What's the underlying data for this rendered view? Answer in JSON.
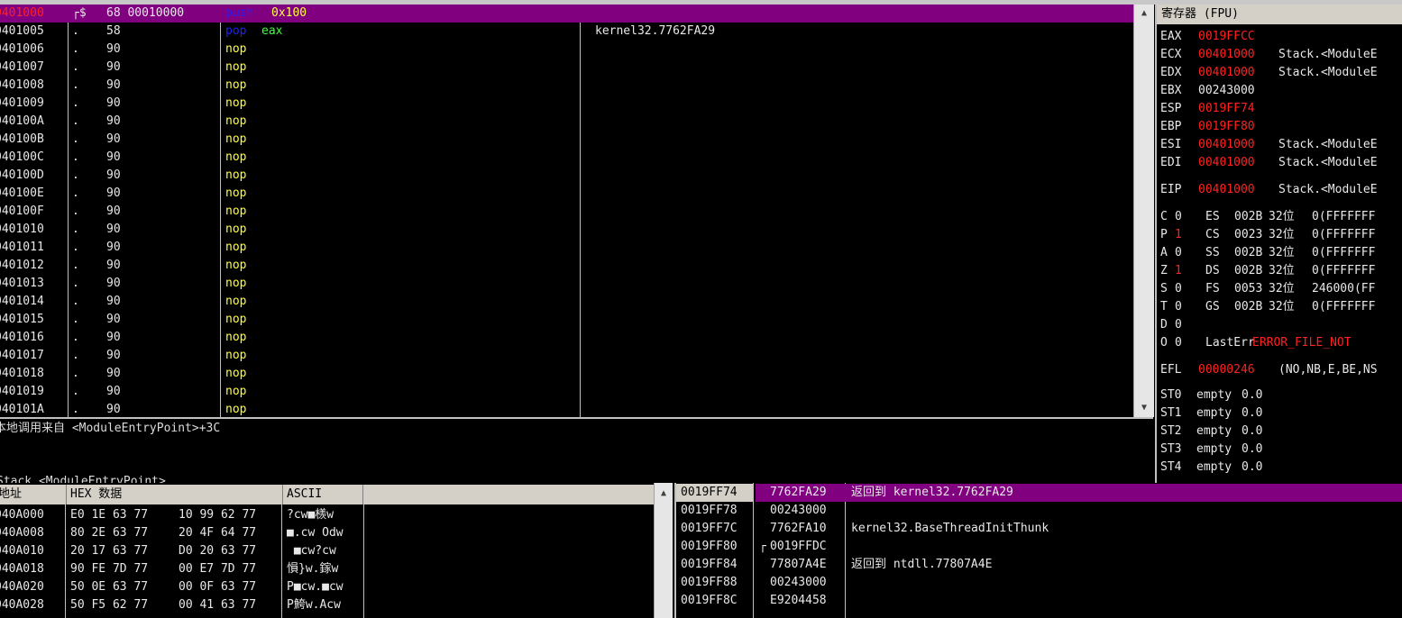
{
  "disasm": {
    "rows": [
      {
        "addr": "0401000",
        "mark": "┌$",
        "bytes": "68 00010000",
        "mnem": "push",
        "op": "0x100",
        "comment": "",
        "selected": true
      },
      {
        "addr": "0401005",
        "mark": ".",
        "bytes": "58",
        "mnem": "pop",
        "op": "eax",
        "comment": "kernel32.7762FA29",
        "selected": false
      },
      {
        "addr": "0401006",
        "mark": ".",
        "bytes": "90",
        "mnem": "nop",
        "op": "",
        "comment": "",
        "selected": false
      },
      {
        "addr": "0401007",
        "mark": ".",
        "bytes": "90",
        "mnem": "nop",
        "op": "",
        "comment": "",
        "selected": false
      },
      {
        "addr": "0401008",
        "mark": ".",
        "bytes": "90",
        "mnem": "nop",
        "op": "",
        "comment": "",
        "selected": false
      },
      {
        "addr": "0401009",
        "mark": ".",
        "bytes": "90",
        "mnem": "nop",
        "op": "",
        "comment": "",
        "selected": false
      },
      {
        "addr": "040100A",
        "mark": ".",
        "bytes": "90",
        "mnem": "nop",
        "op": "",
        "comment": "",
        "selected": false
      },
      {
        "addr": "040100B",
        "mark": ".",
        "bytes": "90",
        "mnem": "nop",
        "op": "",
        "comment": "",
        "selected": false
      },
      {
        "addr": "040100C",
        "mark": ".",
        "bytes": "90",
        "mnem": "nop",
        "op": "",
        "comment": "",
        "selected": false
      },
      {
        "addr": "040100D",
        "mark": ".",
        "bytes": "90",
        "mnem": "nop",
        "op": "",
        "comment": "",
        "selected": false
      },
      {
        "addr": "040100E",
        "mark": ".",
        "bytes": "90",
        "mnem": "nop",
        "op": "",
        "comment": "",
        "selected": false
      },
      {
        "addr": "040100F",
        "mark": ".",
        "bytes": "90",
        "mnem": "nop",
        "op": "",
        "comment": "",
        "selected": false
      },
      {
        "addr": "0401010",
        "mark": ".",
        "bytes": "90",
        "mnem": "nop",
        "op": "",
        "comment": "",
        "selected": false
      },
      {
        "addr": "0401011",
        "mark": ".",
        "bytes": "90",
        "mnem": "nop",
        "op": "",
        "comment": "",
        "selected": false
      },
      {
        "addr": "0401012",
        "mark": ".",
        "bytes": "90",
        "mnem": "nop",
        "op": "",
        "comment": "",
        "selected": false
      },
      {
        "addr": "0401013",
        "mark": ".",
        "bytes": "90",
        "mnem": "nop",
        "op": "",
        "comment": "",
        "selected": false
      },
      {
        "addr": "0401014",
        "mark": ".",
        "bytes": "90",
        "mnem": "nop",
        "op": "",
        "comment": "",
        "selected": false
      },
      {
        "addr": "0401015",
        "mark": ".",
        "bytes": "90",
        "mnem": "nop",
        "op": "",
        "comment": "",
        "selected": false
      },
      {
        "addr": "0401016",
        "mark": ".",
        "bytes": "90",
        "mnem": "nop",
        "op": "",
        "comment": "",
        "selected": false
      },
      {
        "addr": "0401017",
        "mark": ".",
        "bytes": "90",
        "mnem": "nop",
        "op": "",
        "comment": "",
        "selected": false
      },
      {
        "addr": "0401018",
        "mark": ".",
        "bytes": "90",
        "mnem": "nop",
        "op": "",
        "comment": "",
        "selected": false
      },
      {
        "addr": "0401019",
        "mark": ".",
        "bytes": "90",
        "mnem": "nop",
        "op": "",
        "comment": "",
        "selected": false
      },
      {
        "addr": "040101A",
        "mark": ".",
        "bytes": "90",
        "mnem": "nop",
        "op": "",
        "comment": "",
        "selected": false
      }
    ]
  },
  "info": {
    "line1": "本地调用来自 <ModuleEntryPoint>+3C",
    "line2": "Stack.<ModuleEntryPoint>"
  },
  "registers": {
    "title": "寄存器 (FPU)",
    "gp": [
      {
        "name": "EAX",
        "value": "0019FFCC",
        "note": ""
      },
      {
        "name": "ECX",
        "value": "00401000",
        "note": "Stack.<ModuleE"
      },
      {
        "name": "EDX",
        "value": "00401000",
        "note": "Stack.<ModuleE"
      },
      {
        "name": "EBX",
        "value": "00243000",
        "note": ""
      },
      {
        "name": "ESP",
        "value": "0019FF74",
        "note": ""
      },
      {
        "name": "EBP",
        "value": "0019FF80",
        "note": ""
      },
      {
        "name": "ESI",
        "value": "00401000",
        "note": "Stack.<ModuleE"
      },
      {
        "name": "EDI",
        "value": "00401000",
        "note": "Stack.<ModuleE"
      }
    ],
    "eip": {
      "name": "EIP",
      "value": "00401000",
      "note": "Stack.<ModuleE"
    },
    "flags": [
      {
        "flag": "C",
        "bit": "0",
        "seg": "ES",
        "sel": "002B",
        "bits": "32位",
        "base": "0(FFFFFFF"
      },
      {
        "flag": "P",
        "bit": "1",
        "seg": "CS",
        "sel": "0023",
        "bits": "32位",
        "base": "0(FFFFFFF"
      },
      {
        "flag": "A",
        "bit": "0",
        "seg": "SS",
        "sel": "002B",
        "bits": "32位",
        "base": "0(FFFFFFF"
      },
      {
        "flag": "Z",
        "bit": "1",
        "seg": "DS",
        "sel": "002B",
        "bits": "32位",
        "base": "0(FFFFFFF"
      },
      {
        "flag": "S",
        "bit": "0",
        "seg": "FS",
        "sel": "0053",
        "bits": "32位",
        "base": "246000(FF"
      },
      {
        "flag": "T",
        "bit": "0",
        "seg": "GS",
        "sel": "002B",
        "bits": "32位",
        "base": "0(FFFFFFF"
      },
      {
        "flag": "D",
        "bit": "0",
        "seg": "",
        "sel": "",
        "bits": "",
        "base": ""
      },
      {
        "flag": "O",
        "bit": "0",
        "seg": "LastErr",
        "sel": "",
        "bits": "",
        "base": "ERROR_FILE_NOT"
      }
    ],
    "efl": {
      "name": "EFL",
      "value": "00000246",
      "note": "(NO,NB,E,BE,NS"
    },
    "fpu": [
      {
        "name": "ST0",
        "state": "empty",
        "value": "0.0"
      },
      {
        "name": "ST1",
        "state": "empty",
        "value": "0.0"
      },
      {
        "name": "ST2",
        "state": "empty",
        "value": "0.0"
      },
      {
        "name": "ST3",
        "state": "empty",
        "value": "0.0"
      },
      {
        "name": "ST4",
        "state": "empty",
        "value": "0.0"
      }
    ]
  },
  "dump": {
    "headers": {
      "addr": "地址",
      "hex": "HEX 数据",
      "ascii": "ASCII"
    },
    "rows": [
      {
        "addr": "040A000",
        "h1": "E0 1E 63 77",
        "h2": "10 99 62 77",
        "ascii": "?cw■檨w"
      },
      {
        "addr": "040A008",
        "h1": "80 2E 63 77",
        "h2": "20 4F 64 77",
        "ascii": "■.cw Odw"
      },
      {
        "addr": "040A010",
        "h1": "20 17 63 77",
        "h2": "D0 20 63 77",
        "ascii": " ■cw?cw"
      },
      {
        "addr": "040A018",
        "h1": "90 FE 7D 77",
        "h2": "00 E7 7D 77",
        "ascii": "愪}w.鎵w"
      },
      {
        "addr": "040A020",
        "h1": "50 0E 63 77",
        "h2": "00 0F 63 77",
        "ascii": "P■cw.■cw"
      },
      {
        "addr": "040A028",
        "h1": "50 F5 62 77",
        "h2": "00 41 63 77",
        "ascii": "P鮬w.Acw"
      }
    ]
  },
  "stack": {
    "rows": [
      {
        "addr": "0019FF74",
        "mark": "",
        "value": "7762FA29",
        "comment": "返回到 kernel32.7762FA29",
        "selected": true
      },
      {
        "addr": "0019FF78",
        "mark": "",
        "value": "00243000",
        "comment": "",
        "selected": false
      },
      {
        "addr": "0019FF7C",
        "mark": "",
        "value": "7762FA10",
        "comment": "kernel32.BaseThreadInitThunk",
        "selected": false
      },
      {
        "addr": "0019FF80",
        "mark": "┌",
        "value": "0019FFDC",
        "comment": "",
        "selected": false
      },
      {
        "addr": "0019FF84",
        "mark": "",
        "value": "77807A4E",
        "comment": "返回到 ntdll.77807A4E",
        "selected": false
      },
      {
        "addr": "0019FF88",
        "mark": "",
        "value": "00243000",
        "comment": "",
        "selected": false
      },
      {
        "addr": "0019FF8C",
        "mark": "",
        "value": "E9204458",
        "comment": "",
        "selected": false
      }
    ]
  },
  "colors": {
    "selection": "#800080",
    "highlight": "#ff2020",
    "text": "#dcdcdc",
    "instr": "#ffff40"
  }
}
